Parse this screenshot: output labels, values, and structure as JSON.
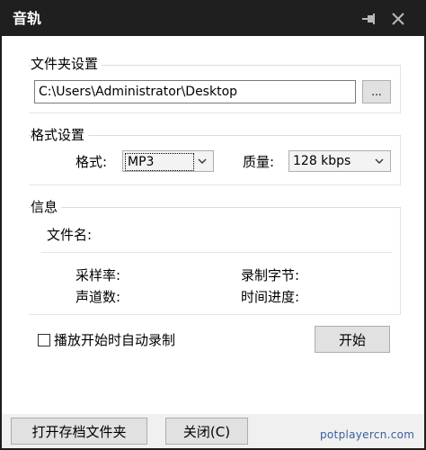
{
  "window": {
    "title": "音轨"
  },
  "folder_group": {
    "title": "文件夹设置",
    "path_value": "C:\\Users\\Administrator\\Desktop",
    "browse_label": "..."
  },
  "format_group": {
    "title": "格式设置",
    "format_label": "格式:",
    "format_value": "MP3",
    "quality_label": "质量:",
    "quality_value": "128 kbps"
  },
  "info_group": {
    "title": "信息",
    "filename_label": "文件名:",
    "samplerate_label": "采样率:",
    "recorded_bytes_label": "录制字节:",
    "channels_label": "声道数:",
    "time_progress_label": "时间进度:"
  },
  "options": {
    "auto_record_label": "播放开始时自动录制",
    "auto_record_checked": false,
    "start_label": "开始"
  },
  "footer": {
    "open_folder_label": "打开存档文件夹",
    "close_label": "关闭(C)",
    "watermark": "potplayercn.com"
  },
  "icons": {
    "pin": "pin-icon",
    "close": "close-icon",
    "dropdown": "chevron-down-icon"
  }
}
